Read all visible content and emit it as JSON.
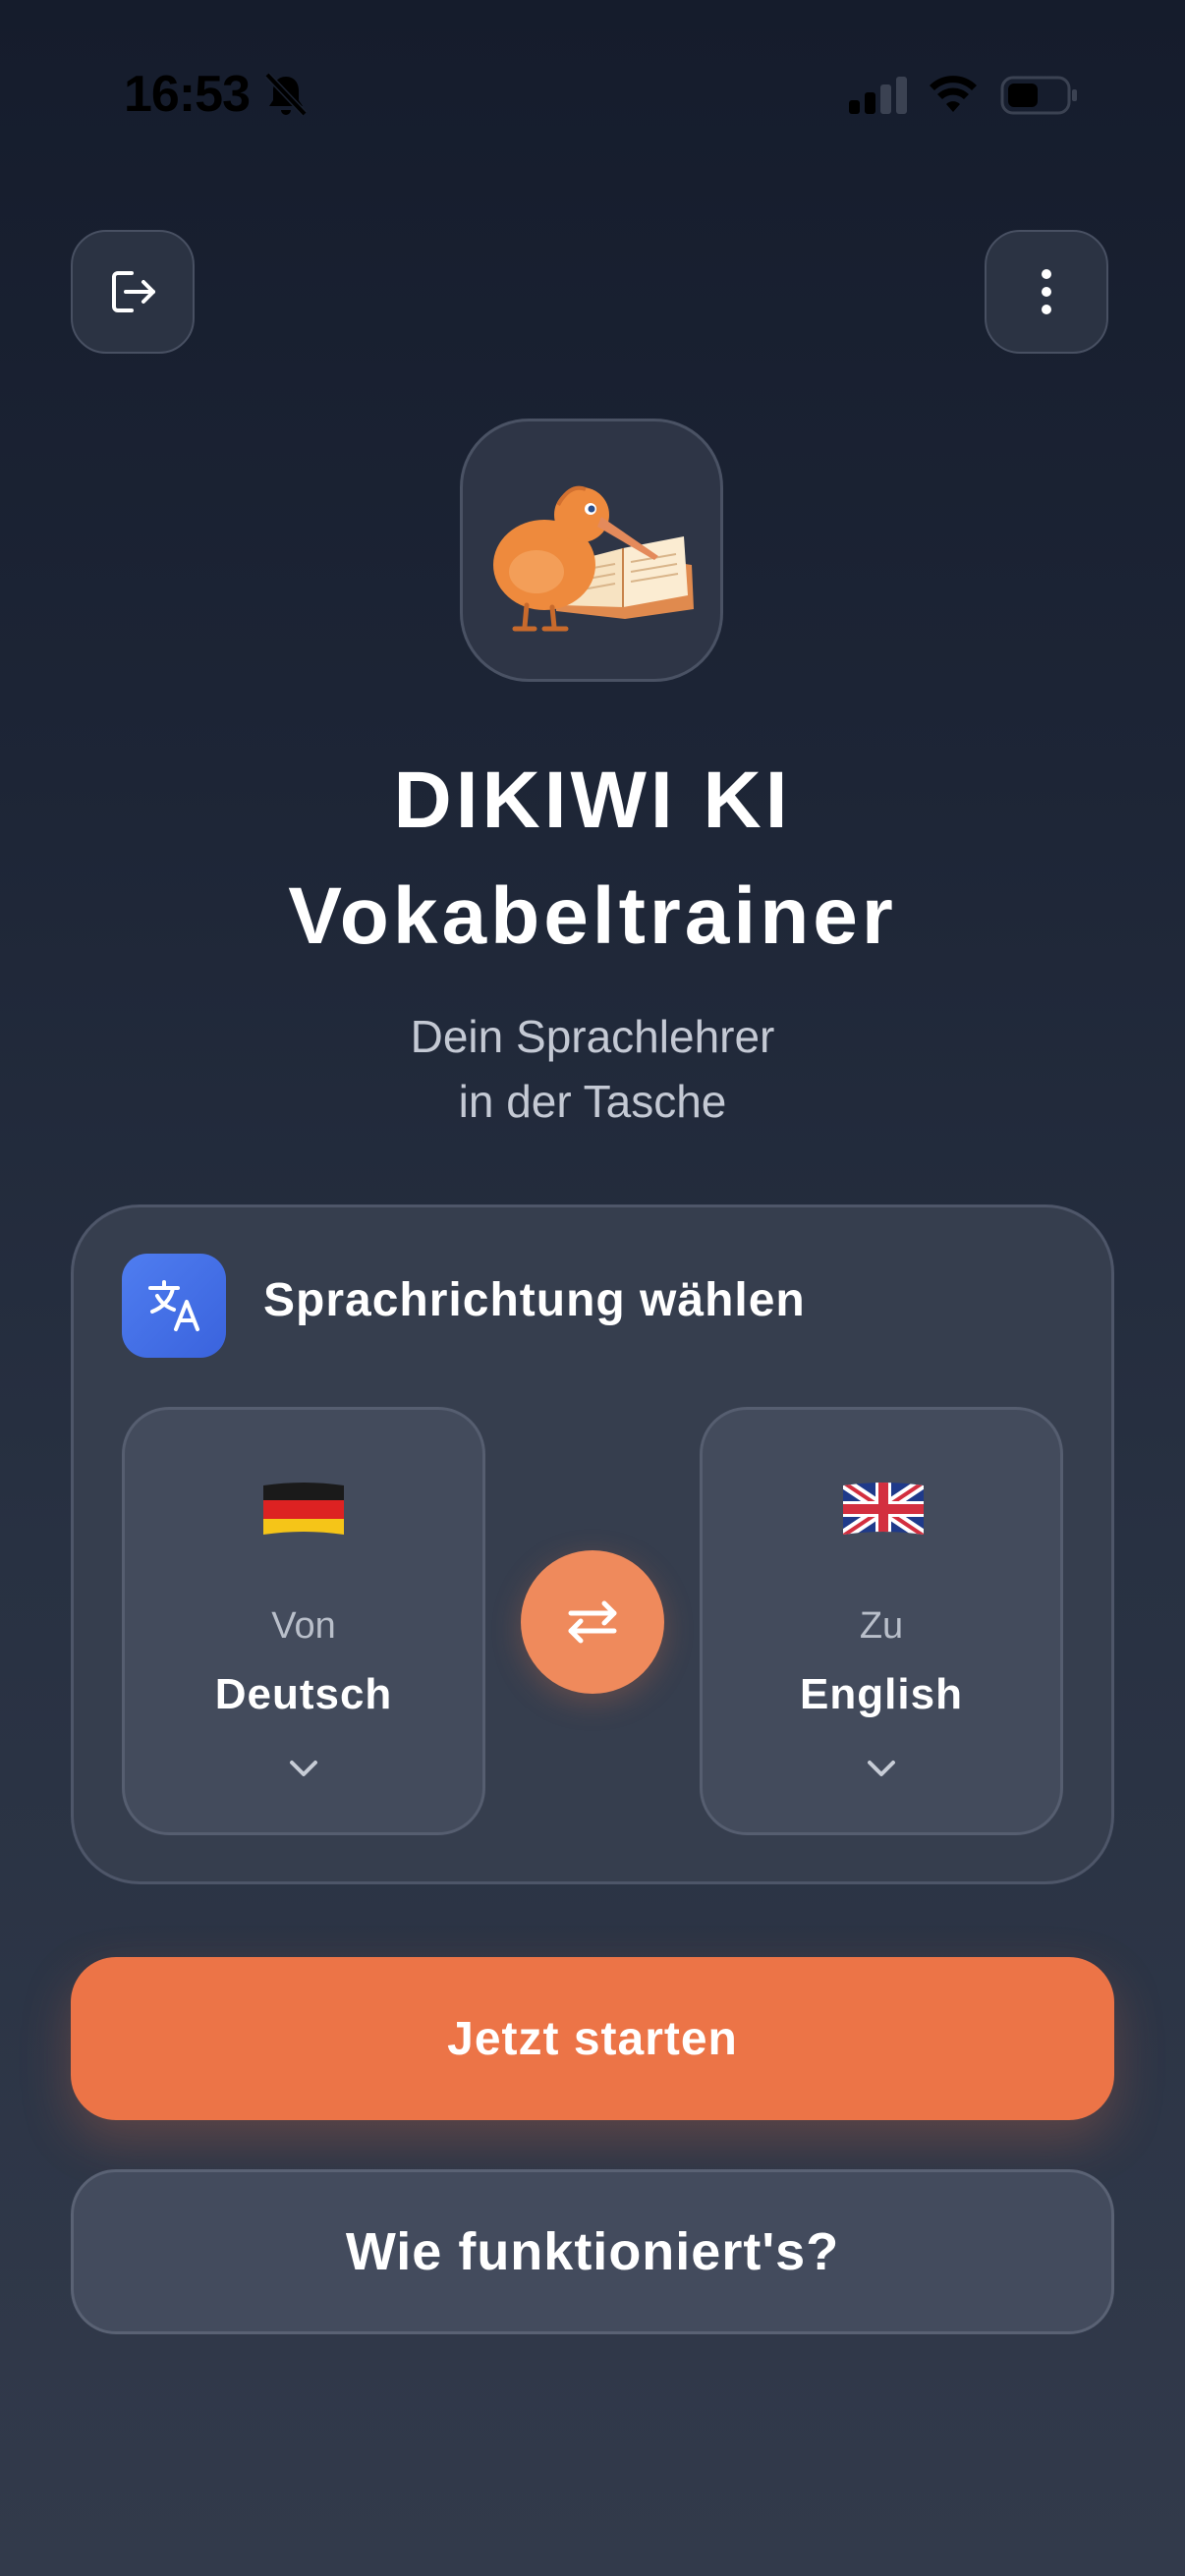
{
  "status_bar": {
    "time": "16:53"
  },
  "app": {
    "title_line1": "DIKIWI KI",
    "title_line2": "Vokabeltrainer",
    "subtitle_line1": "Dein Sprachlehrer",
    "subtitle_line2": "in der Tasche"
  },
  "language_card": {
    "title": "Sprachrichtung wählen",
    "from": {
      "caption": "Von",
      "language": "Deutsch",
      "flag": "german-flag"
    },
    "to": {
      "caption": "Zu",
      "language": "English",
      "flag": "uk-flag"
    }
  },
  "buttons": {
    "start": "Jetzt starten",
    "how_it_works": "Wie funktioniert's?"
  },
  "icons": {
    "exit": "exit-icon",
    "more": "more-vertical-icon",
    "translate": "translate-icon",
    "swap": "swap-arrows-icon"
  },
  "colors": {
    "accent": "#ec7447",
    "translate_badge": "#4a74ec"
  }
}
